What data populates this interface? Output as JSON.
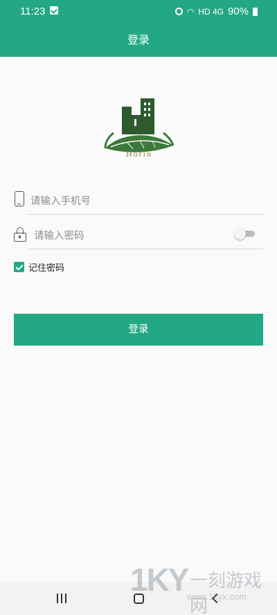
{
  "status_bar": {
    "time": "11:23",
    "signal": "HD 4G",
    "battery": "90%"
  },
  "header": {
    "title": "登录",
    "color": "#22a884"
  },
  "logo": {
    "text": "Horin"
  },
  "form": {
    "phone_placeholder": "请输入手机号",
    "password_placeholder": "请输入密码",
    "show_password_toggle": false,
    "remember_label": "记住密码",
    "remember_checked": true,
    "login_button": "登录"
  },
  "watermark": {
    "big": "1KY",
    "cn": "一刻游戏网",
    "url": "www.1kyx.com"
  },
  "icons": [
    "phone-icon",
    "lock-icon",
    "alarm-icon",
    "wifi-icon",
    "battery-icon",
    "check-icon",
    "recent-apps-icon",
    "home-icon",
    "back-icon"
  ]
}
